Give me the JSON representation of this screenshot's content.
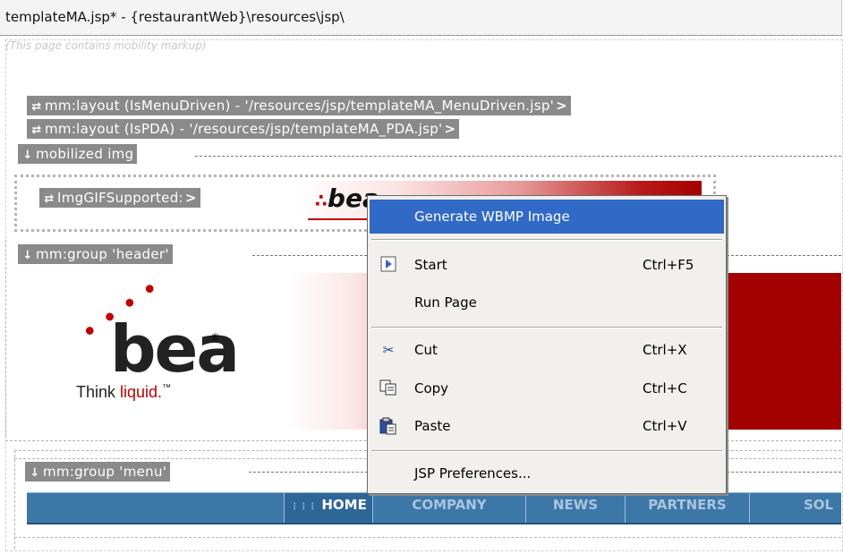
{
  "editor": {
    "title": "templateMA.jsp* - {restaurantWeb}\\resources\\jsp\\",
    "note": "(This page contains mobility markup)"
  },
  "tags": {
    "layout_menu": "mm:layout (IsMenuDriven) - '/resources/jsp/templateMA_MenuDriven.jsp'",
    "layout_pda": "mm:layout (IsPDA) - '/resources/jsp/templateMA_PDA.jsp'",
    "mobilized_img": "mobilized img",
    "img_gif": "ImgGIFSupported:",
    "group_header": "mm:group 'header'",
    "group_menu": "mm:group 'menu'",
    "tail_symbol": ">"
  },
  "logo": {
    "wordmark": "bea",
    "tagline_think": "Think",
    "tagline_liquid": "liquid.",
    "tm": "™",
    "registered": "®"
  },
  "nav": [
    "HOME",
    "COMPANY",
    "NEWS",
    "PARTNERS",
    "SOL"
  ],
  "context_menu": {
    "items": [
      {
        "label": "Generate WBMP Image",
        "shortcut": "",
        "icon": "none",
        "selected": true
      },
      {
        "label": "Start",
        "shortcut": "Ctrl+F5",
        "icon": "start-icon"
      },
      {
        "label": "Run Page",
        "shortcut": "",
        "icon": "none"
      },
      {
        "label": "Cut",
        "shortcut": "Ctrl+X",
        "icon": "scissors-icon"
      },
      {
        "label": "Copy",
        "shortcut": "Ctrl+C",
        "icon": "copy-icon"
      },
      {
        "label": "Paste",
        "shortcut": "Ctrl+V",
        "icon": "paste-icon"
      },
      {
        "label": "JSP Preferences...",
        "shortcut": "",
        "icon": "none"
      }
    ]
  },
  "colors": {
    "tag_bg": "#8a8a8a",
    "menu_highlight": "#3169c6",
    "nav_bg": "#3d77a8",
    "brand_red": "#a30000"
  }
}
